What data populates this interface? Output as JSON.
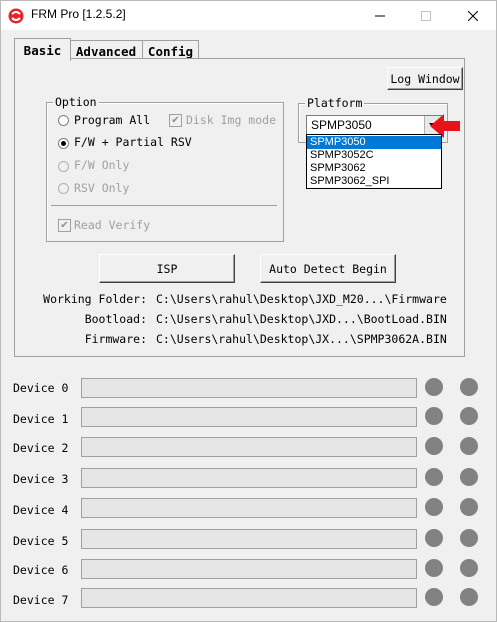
{
  "window": {
    "title": "FRM Pro [1.2.5.2]",
    "minimize_glyph": "—",
    "maximize_glyph": "☐",
    "close_glyph": "✕"
  },
  "tabs": [
    {
      "label": "Basic",
      "active": true
    },
    {
      "label": "Advanced",
      "active": false
    },
    {
      "label": "Config",
      "active": false
    }
  ],
  "buttons": {
    "log_window": "Log Window",
    "isp": "ISP",
    "auto_detect": "Auto Detect Begin"
  },
  "option": {
    "legend": "Option",
    "program_all": "Program All",
    "disk_img_mode": "Disk Img mode",
    "fw_partial_rsv": "F/W + Partial RSV",
    "fw_only": "F/W Only",
    "rsv_only": "RSV Only",
    "read_verify": "Read Verify",
    "selected": "F/W + Partial RSV"
  },
  "platform": {
    "legend": "Platform",
    "selected": "SPMP3050",
    "options": [
      "SPMP3050",
      "SPMP3052C",
      "SPMP3062",
      "SPMP3062_SPI"
    ]
  },
  "info": {
    "working_folder_label": "Working Folder:",
    "working_folder_value": "C:\\Users\\rahul\\Desktop\\JXD_M20...\\Firmware",
    "bootload_label": "Bootload:",
    "bootload_value": "C:\\Users\\rahul\\Desktop\\JXD...\\BootLoad.BIN",
    "firmware_label": "Firmware:",
    "firmware_value": "C:\\Users\\rahul\\Desktop\\JX...\\SPMP3062A.BIN"
  },
  "devices": [
    {
      "label": "Device 0",
      "progress": 0
    },
    {
      "label": "Device 1",
      "progress": 0
    },
    {
      "label": "Device 2",
      "progress": 0
    },
    {
      "label": "Device 3",
      "progress": 0
    },
    {
      "label": "Device 4",
      "progress": 0
    },
    {
      "label": "Device 5",
      "progress": 0
    },
    {
      "label": "Device 6",
      "progress": 0
    },
    {
      "label": "Device 7",
      "progress": 0
    }
  ],
  "colors": {
    "accent_selection": "#0078d7",
    "annotation_arrow": "#e8121a",
    "led_idle": "#828282"
  }
}
